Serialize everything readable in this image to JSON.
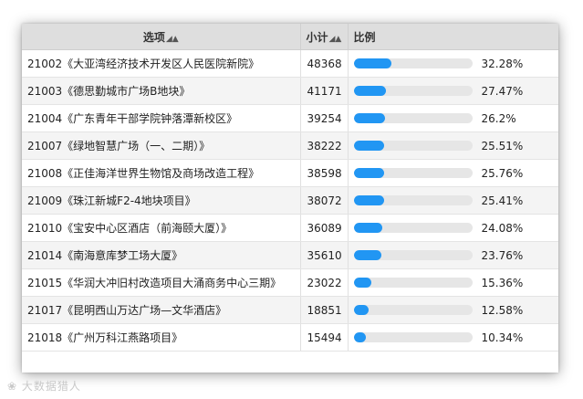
{
  "table": {
    "columns": {
      "name": "选项",
      "sum": "小计",
      "ratio": "比例"
    },
    "sort_icon": "sort-triangle-icon",
    "bar_color": "#2196f3",
    "rows": [
      {
        "name": "21002《大亚湾经济技术开发区人民医院新院》",
        "sum": "48368",
        "pct": "32.28%",
        "value": 32.28
      },
      {
        "name": "21003《德思勤城市广场B地块》",
        "sum": "41171",
        "pct": "27.47%",
        "value": 27.47
      },
      {
        "name": "21004《广东青年干部学院钟落潭新校区》",
        "sum": "39254",
        "pct": "26.2%",
        "value": 26.2
      },
      {
        "name": "21007《绿地智慧广场（一、二期）》",
        "sum": "38222",
        "pct": "25.51%",
        "value": 25.51
      },
      {
        "name": "21008《正佳海洋世界生物馆及商场改造工程》",
        "sum": "38598",
        "pct": "25.76%",
        "value": 25.76
      },
      {
        "name": "21009《珠江新城F2-4地块项目》",
        "sum": "38072",
        "pct": "25.41%",
        "value": 25.41
      },
      {
        "name": "21010《宝安中心区酒店（前海颐大厦）》",
        "sum": "36089",
        "pct": "24.08%",
        "value": 24.08
      },
      {
        "name": "21014《南海意库梦工场大厦》",
        "sum": "35610",
        "pct": "23.76%",
        "value": 23.76
      },
      {
        "name": "21015《华润大冲旧村改造项目大涌商务中心三期》",
        "sum": "23022",
        "pct": "15.36%",
        "value": 15.36
      },
      {
        "name": "21017《昆明西山万达广场—文华酒店》",
        "sum": "18851",
        "pct": "12.58%",
        "value": 12.58
      },
      {
        "name": "21018《广州万科江燕路项目》",
        "sum": "15494",
        "pct": "10.34%",
        "value": 10.34
      }
    ]
  },
  "watermark": "大数据猎人"
}
